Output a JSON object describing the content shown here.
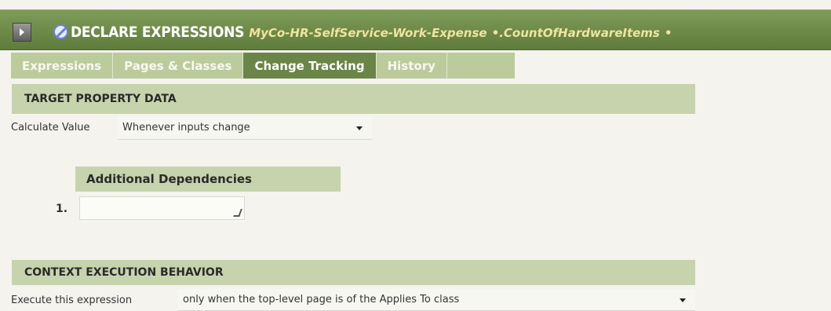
{
  "header": {
    "rule_type": "DECLARE EXPRESSIONS",
    "class_name": "MyCo-HR-SelfService-Work-Expense",
    "separator": "•",
    "property_name": ".CountOfHardwareItems",
    "trailing": "•"
  },
  "tabs": [
    {
      "label": "Expressions",
      "active": false
    },
    {
      "label": "Pages & Classes",
      "active": false
    },
    {
      "label": "Change Tracking",
      "active": true
    },
    {
      "label": "History",
      "active": false
    }
  ],
  "target_section": {
    "heading": "TARGET PROPERTY DATA",
    "calculate_label": "Calculate Value",
    "calculate_value": "Whenever inputs change"
  },
  "dependencies_section": {
    "heading": "Additional Dependencies",
    "row_number": "1.",
    "row_value": ""
  },
  "context_section": {
    "heading": "CONTEXT EXECUTION BEHAVIOR",
    "execute_label": "Execute this expression",
    "execute_value": "only when the top-level page is of the Applies To class"
  },
  "icons": {
    "expand": "expand-arrow-icon",
    "rule": "declare-expression-icon",
    "dropdown": "chevron-down-icon",
    "resize": "resize-grip-icon"
  },
  "colors": {
    "title_bar": "#6a8547",
    "tab_active": "#6a8547",
    "tab_inactive": "#bccb9c",
    "section_band": "#c7d3ad",
    "title_accent": "#f0e3a0"
  }
}
